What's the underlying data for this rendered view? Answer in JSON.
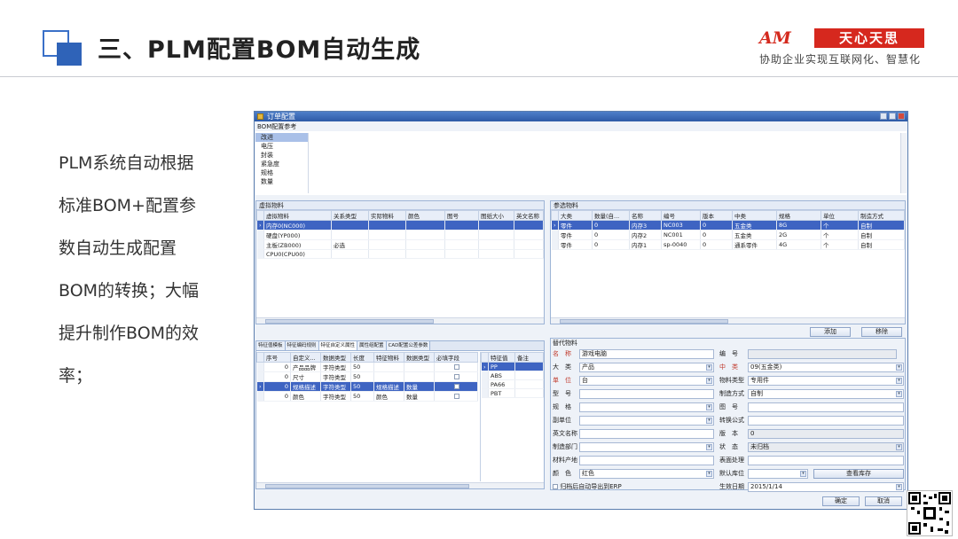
{
  "slide": {
    "title": "三、PLM配置BOM自动生成",
    "logo_am": "AM",
    "logo_badge": "天心天思",
    "slogan": "协助企业实现互联网化、智慧化",
    "body_lines": [
      "PLM系统自动根据",
      "标准BOM+配置参",
      "数自动生成配置",
      "BOM的转换；大幅",
      "提升制作BOM的效",
      "率；"
    ]
  },
  "window": {
    "title": "订单配置",
    "bom_ref": {
      "header": "BOM配置参考",
      "items": [
        "改进",
        "电压",
        "封装",
        "紧急度",
        "规格",
        "数量"
      ]
    },
    "virtual": {
      "header": "虚拟物料",
      "columns": [
        "虚拟物料",
        "关系类型",
        "实际物料",
        "颜色",
        "图号",
        "图纸大小",
        "英文名称"
      ],
      "rows": [
        [
          "内存0(NC000)",
          "",
          "",
          "",
          "",
          "",
          ""
        ],
        [
          "硬盘(YP000)",
          "",
          "",
          "",
          "",
          "",
          ""
        ],
        [
          "主板(ZB000)",
          "必选",
          "",
          "",
          "",
          "",
          ""
        ],
        [
          "CPU0(CPU00)",
          "",
          "",
          "",
          "",
          "",
          ""
        ]
      ]
    },
    "ref": {
      "header": "参选物料",
      "columns": [
        "大类",
        "数量(自...",
        "名称",
        "编号",
        "版本",
        "中类",
        "规格",
        "单位",
        "制造方式"
      ],
      "rows": [
        [
          "零件",
          "0",
          "内存3",
          "NC003",
          "0",
          "五金类",
          "8G",
          "个",
          "自制"
        ],
        [
          "零件",
          "0",
          "内存2",
          "NC001",
          "0",
          "五金类",
          "2G",
          "个",
          "自制"
        ],
        [
          "零件",
          "0",
          "内存1",
          "sp-0040",
          "0",
          "通系零件",
          "4G",
          "个",
          "自制"
        ]
      ],
      "add_label": "添加",
      "delete_label": "移除"
    },
    "attr": {
      "tabs": [
        "特征值模板",
        "特征编码规则",
        "特征自定义属性",
        "属性组配置",
        "CAD配置公差参数"
      ],
      "columns": [
        "序号",
        "自定义...",
        "数据类型",
        "长度",
        "特征物料",
        "数据类型",
        "必填字段"
      ],
      "rows": [
        [
          "0",
          "产品品牌",
          "字符类型",
          "50",
          "",
          "",
          ""
        ],
        [
          "0",
          "尺寸",
          "字符类型",
          "50",
          "",
          "",
          ""
        ],
        [
          "0",
          "规格描述",
          "字符类型",
          "50",
          "规格描述",
          "数量",
          ""
        ],
        [
          "0",
          "颜色",
          "字符类型",
          "50",
          "颜色",
          "数量",
          ""
        ]
      ],
      "value_columns": [
        "特征值",
        "备注"
      ],
      "values": [
        "PP",
        "ABS",
        "PA66",
        "PBT"
      ]
    },
    "sub": {
      "header": "替代物料",
      "fields": {
        "name_label": "名　称",
        "name": "游戏电脑",
        "code_label": "编　号",
        "code": "",
        "big_label": "大　类",
        "big": "产品",
        "mid_label": "中　类",
        "mid": "09(五金类)",
        "unit_label": "单　位",
        "unit": "台",
        "mtype_label": "物料类型",
        "mtype": "专用件",
        "model_label": "型　号",
        "model": "",
        "make_label": "制造方式",
        "make": "自制",
        "spec_label": "规　格",
        "spec": "",
        "draw_label": "图　号",
        "draw": "",
        "subunit_label": "副单位",
        "subunit": "",
        "formula_label": "转换公式",
        "formula": "",
        "en_label": "英文名称",
        "en": "",
        "ver_label": "版　本",
        "ver": "0",
        "dept_label": "制造部门",
        "dept": "",
        "state_label": "状　态",
        "state": "未归档",
        "origin_label": "材料产地",
        "origin": "",
        "surface_label": "表面处理",
        "surface": "",
        "color_label": "颜　色",
        "color": "红色",
        "loc_label": "默认库位",
        "loc": "",
        "date_label": "生效日期",
        "date": "2015/1/14",
        "erp_label": "归档后自动导出到ERP",
        "stock_label": "查看库存"
      }
    },
    "ok_label": "确定",
    "cancel_label": "取消"
  }
}
